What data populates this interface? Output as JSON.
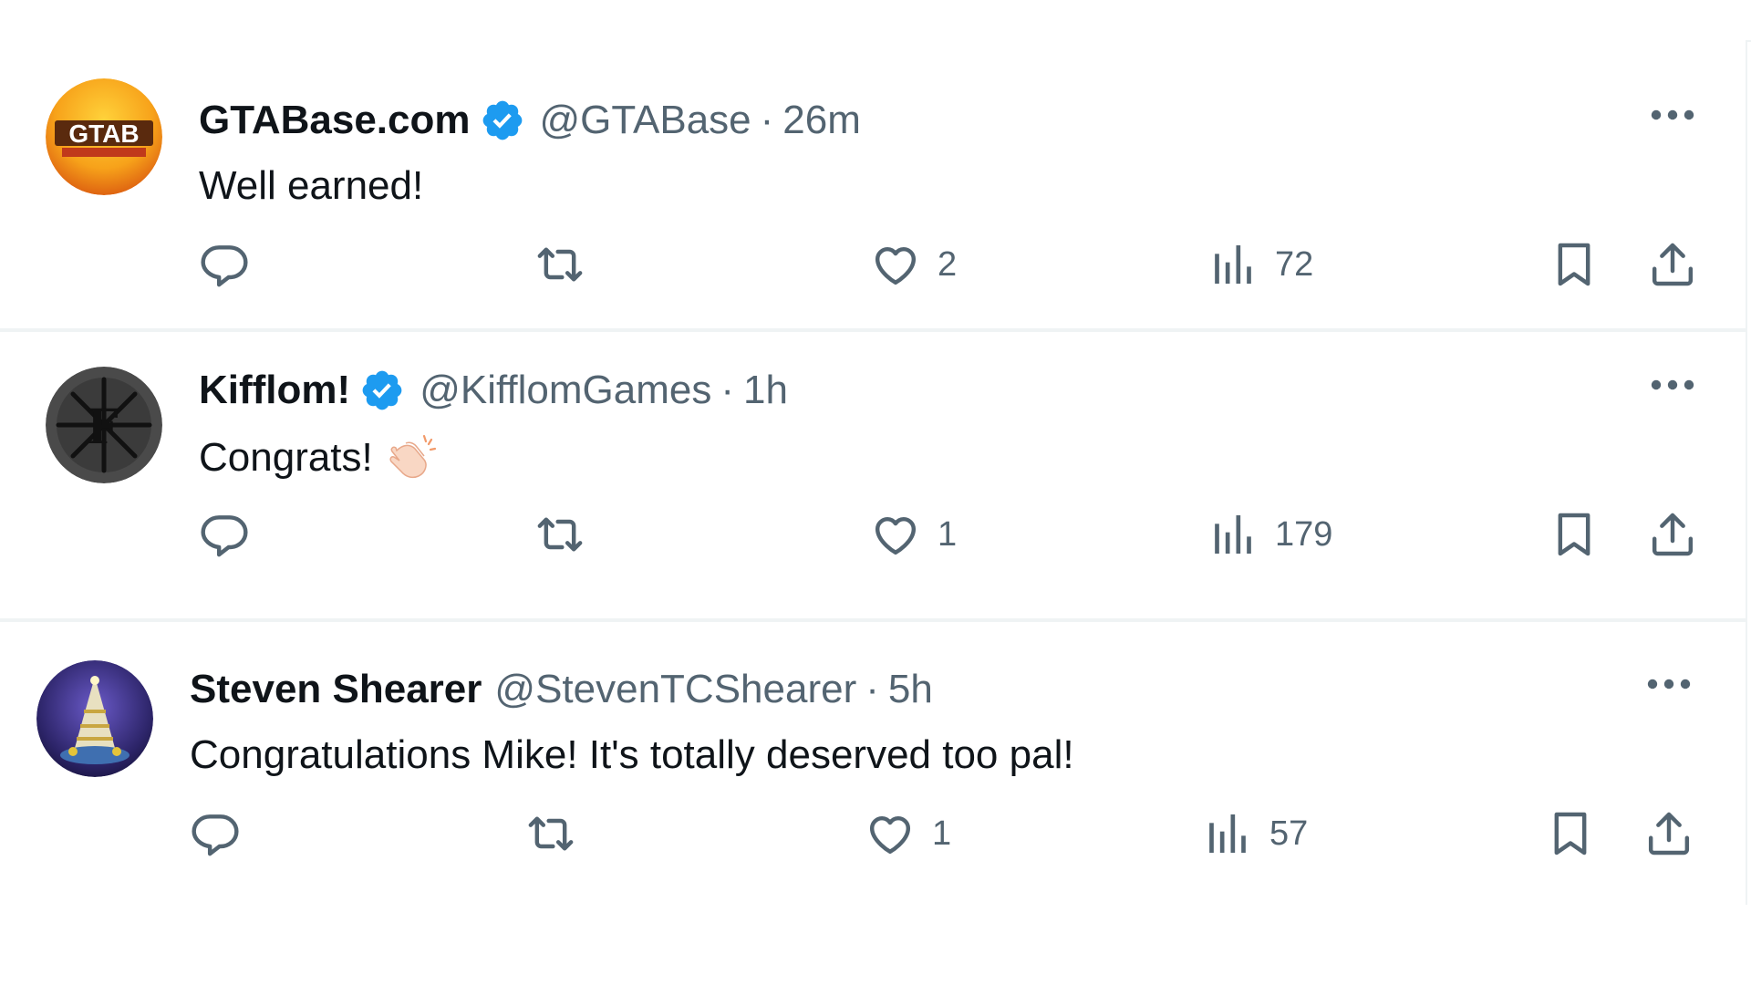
{
  "colors": {
    "verified": "#1d9bf0",
    "secondary_text": "#536471",
    "primary_text": "#0f1419",
    "divider": "#eff3f4"
  },
  "tweets": [
    {
      "display_name": "GTABase.com",
      "verified": true,
      "handle": "@GTABase",
      "separator": "·",
      "time": "26m",
      "text": "Well earned!",
      "avatar_icon": "gtabase-logo",
      "replies": "",
      "retweets": "",
      "likes": "2",
      "views": "72"
    },
    {
      "display_name": "Kifflom!",
      "verified": true,
      "handle": "@KifflomGames",
      "separator": "·",
      "time": "1h",
      "text": "Congrats!",
      "emoji_icon": "clapping-hands-icon",
      "avatar_icon": "kifflom-logo",
      "replies": "",
      "retweets": "",
      "likes": "1",
      "views": "179"
    },
    {
      "display_name": "Steven Shearer",
      "verified": false,
      "handle": "@StevenTCShearer",
      "separator": "·",
      "time": "5h",
      "text": "Congratulations Mike! It's totally deserved too pal!",
      "avatar_icon": "profile-photo",
      "replies": "",
      "retweets": "",
      "likes": "1",
      "views": "57"
    }
  ]
}
